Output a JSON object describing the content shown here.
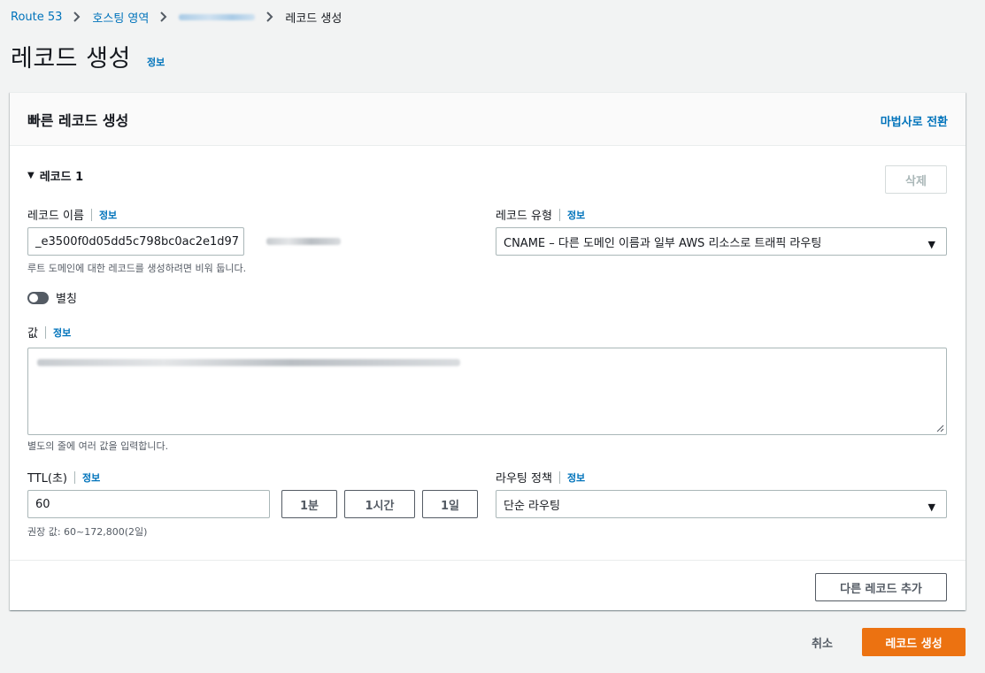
{
  "breadcrumb": {
    "items": [
      "Route 53",
      "호스팅 영역",
      "레코드 생성"
    ]
  },
  "page": {
    "title": "레코드 생성",
    "info_label": "정보"
  },
  "panel": {
    "title": "빠른 레코드 생성",
    "wizard_link": "마법사로 전환",
    "record_section": "레코드 1",
    "delete_button": "삭제",
    "record_name": {
      "label": "레코드 이름",
      "info": "정보",
      "value": "_e3500f0d05dd5c798bc0ac2e1d97",
      "hint": "루트 도메인에 대한 레코드를 생성하려면 비워 둡니다."
    },
    "record_type": {
      "label": "레코드 유형",
      "info": "정보",
      "selected": "CNAME – 다른 도메인 이름과 일부 AWS 리소스로 트래픽 라우팅"
    },
    "alias": {
      "label": "별칭",
      "enabled": false
    },
    "value": {
      "label": "값",
      "info": "정보",
      "hint": "별도의 줄에 여러 값을 입력합니다."
    },
    "ttl": {
      "label": "TTL(초)",
      "info": "정보",
      "value": "60",
      "buttons": [
        "1분",
        "1시간",
        "1일"
      ],
      "hint": "권장 값: 60~172,800(2일)"
    },
    "routing_policy": {
      "label": "라우팅 정책",
      "info": "정보",
      "selected": "단순 라우팅"
    },
    "add_record_button": "다른 레코드 추가"
  },
  "footer": {
    "cancel_label": "취소",
    "submit_label": "레코드 생성"
  },
  "colors": {
    "link": "#0073bb",
    "primary": "#ec7211",
    "background": "#f2f3f3"
  }
}
